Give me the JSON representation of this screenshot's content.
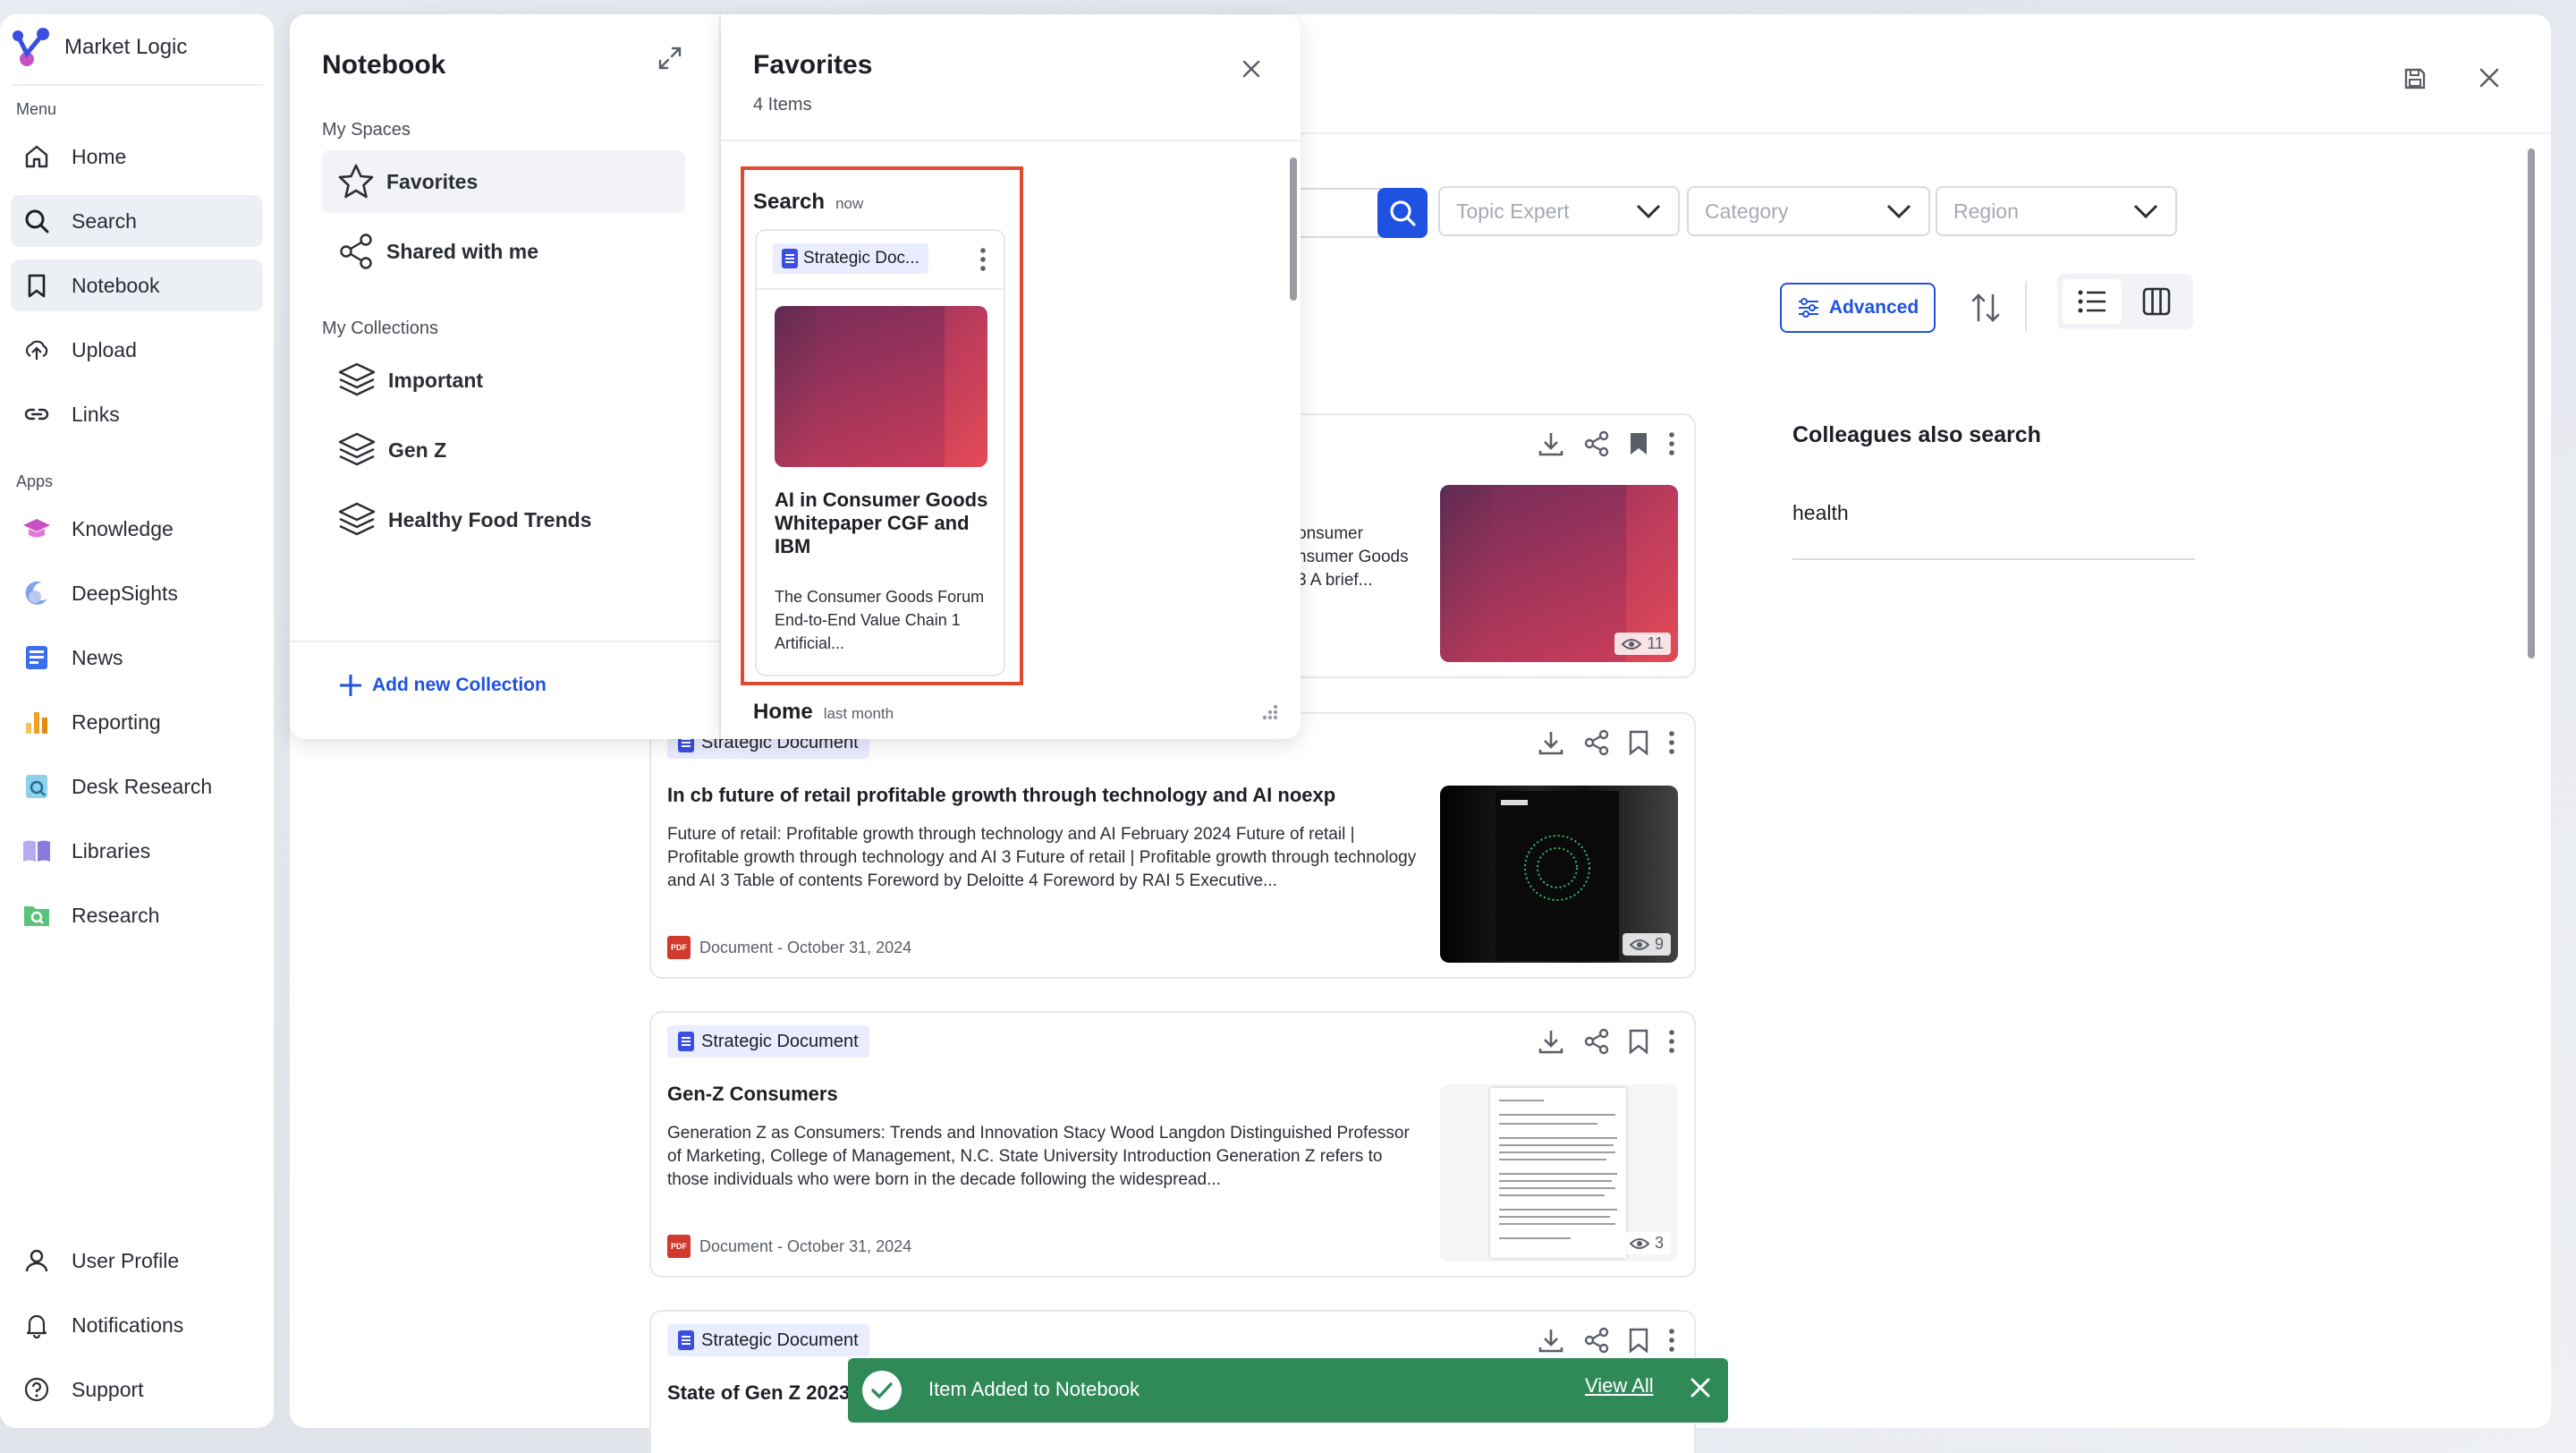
{
  "brand": {
    "name": "Market Logic"
  },
  "sidebar": {
    "menu_label": "Menu",
    "apps_label": "Apps",
    "menu_items": [
      {
        "label": "Home",
        "icon": "home-icon"
      },
      {
        "label": "Search",
        "icon": "search-icon"
      },
      {
        "label": "Notebook",
        "icon": "bookmark-icon"
      },
      {
        "label": "Upload",
        "icon": "upload-icon"
      },
      {
        "label": "Links",
        "icon": "link-icon"
      }
    ],
    "apps": [
      {
        "label": "Knowledge",
        "icon": "graduation-cap-icon",
        "color": "#c94fc4"
      },
      {
        "label": "DeepSights",
        "icon": "moon-icon",
        "color": "#5b8be6"
      },
      {
        "label": "News",
        "icon": "news-icon",
        "color": "#3a6ff0"
      },
      {
        "label": "Reporting",
        "icon": "bar-chart-icon",
        "color": "#f0a020"
      },
      {
        "label": "Desk Research",
        "icon": "desk-research-icon",
        "color": "#3aa7d6"
      },
      {
        "label": "Libraries",
        "icon": "book-icon",
        "color": "#8a7ae0"
      },
      {
        "label": "Research",
        "icon": "folder-search-icon",
        "color": "#3aa85a"
      }
    ],
    "footer_items": [
      {
        "label": "User Profile",
        "icon": "user-icon"
      },
      {
        "label": "Notifications",
        "icon": "bell-icon"
      },
      {
        "label": "Support",
        "icon": "help-icon"
      }
    ]
  },
  "notebook": {
    "title": "Notebook",
    "my_spaces_label": "My Spaces",
    "spaces": [
      {
        "label": "Favorites",
        "icon": "star-icon"
      },
      {
        "label": "Shared with me",
        "icon": "share-icon"
      }
    ],
    "my_collections_label": "My Collections",
    "collections": [
      {
        "label": "Important"
      },
      {
        "label": "Gen Z"
      },
      {
        "label": "Healthy Food Trends"
      }
    ],
    "add_collection": "Add new Collection"
  },
  "favorites": {
    "title": "Favorites",
    "count": "4 Items",
    "groups": [
      {
        "name": "Search",
        "time": "now"
      },
      {
        "name": "Home",
        "time": "last month"
      }
    ],
    "card": {
      "chip": "Strategic Doc...",
      "title": "AI in Consumer Goods Whitepaper CGF and IBM",
      "snippet": "The Consumer Goods Forum End-to-End Value Chain 1 Artificial..."
    }
  },
  "search": {
    "filters": [
      "Topic Expert",
      "Category",
      "Region"
    ],
    "advanced_label": "Advanced"
  },
  "results": [
    {
      "partial_snippet": [
        "onsumer",
        "nsumer Goods",
        "3 A brief..."
      ],
      "views": "11"
    },
    {
      "chip": "Strategic Document",
      "title": "In cb future of retail profitable growth through technology and AI noexp",
      "snippet": "Future of retail: Profitable growth through technology and AI February 2024 Future of retail | Profitable growth through technology and AI 3 Future of retail | Profitable growth through technology and AI 3 Table of contents Foreword by Deloitte 4 Foreword by RAI 5 Executive...",
      "meta": "Document - October 31, 2024",
      "views": "9"
    },
    {
      "chip": "Strategic Document",
      "title": "Gen-Z Consumers",
      "snippet": "Generation Z as Consumers: Trends and Innovation Stacy Wood Langdon Distinguished Professor of Marketing, College of Management, N.C. State University Introduction Generation Z refers to those individuals who were born in the decade following the widespread...",
      "meta": "Document - October 31, 2024",
      "views": "3"
    },
    {
      "chip": "Strategic Document",
      "title": "State of Gen Z 2023"
    }
  ],
  "colleagues": {
    "title": "Colleagues also search",
    "items": [
      "health"
    ]
  },
  "toast": {
    "message": "Item Added to Notebook",
    "link": "View All"
  },
  "colors": {
    "accent": "#1f52e0",
    "toast": "#2f8a58",
    "highlight": "#e04a2f"
  }
}
